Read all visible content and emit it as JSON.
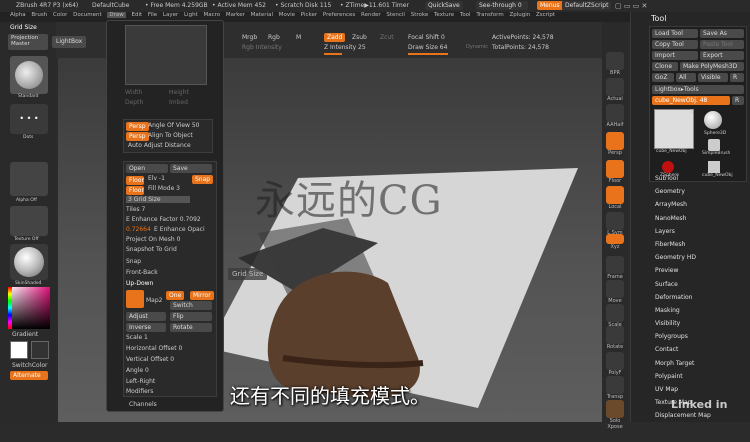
{
  "title_bar": {
    "app": "ZBrush 4R7 P3 (x64)",
    "doc": "DefaultCube",
    "free_mem": "• Free Mem 4.259GB",
    "active_mem": "• Active Mem 452",
    "scratch": "• Scratch Disk 115",
    "ztime": "• ZTime▶11.601 Timer",
    "quicksave": "QuickSave",
    "see_through": "See-through  0",
    "menus": "Menus",
    "script": "DefaultZScript"
  },
  "menu": [
    "Alpha",
    "Brush",
    "Color",
    "Document",
    "Draw",
    "Edit",
    "File",
    "Layer",
    "Light",
    "Macro",
    "Marker",
    "Material",
    "Movie",
    "Picker",
    "Preferences",
    "Render",
    "Stencil",
    "Stroke",
    "Texture",
    "Tool",
    "Transform",
    "Zplugin",
    "Zscript"
  ],
  "left_shelf": {
    "grid_size": "Grid Size",
    "projection_master": "Projection Master",
    "lightbox": "LightBox",
    "standard": "Standard",
    "dots": "Dots",
    "alpha_off": "Alpha Off",
    "texture_off": "Texture Off",
    "matcap": "SkinShade4",
    "gradient": "Gradient",
    "switch_color": "SwitchColor",
    "alternate": "Alternate"
  },
  "top_toolbar": {
    "mrgb": "Mrgb",
    "rgb": "Rgb",
    "m": "M",
    "rgb_intensity": "Rgb Intensity",
    "zadd": "Zadd",
    "zsub": "Zsub",
    "zcut": "Zcut",
    "z_intensity": "Z Intensity 25",
    "focal_shift": "Focal Shift 0",
    "draw_size": "Draw Size 64",
    "dynamic": "Dynamic",
    "active_points": "ActivePoints: 24,578",
    "total_points": "TotalPoints: 24,578"
  },
  "draw_panel": {
    "width": "Width",
    "height": "Height",
    "depth": "Depth",
    "imbed": "Imbed",
    "angle_of_view": "Angle Of View 50",
    "align_to_object": "Align To Object",
    "auto_adjust_distance": "Auto Adjust Distance",
    "persp": "Persp",
    "open": "Open",
    "save": "Save",
    "floor": "Floor",
    "elv": "Elv -1",
    "snap_btn": "Snap",
    "fill_mode": "Fill Mode 3",
    "grid_size": "3 Grid Size",
    "tiles": "Tiles 7",
    "e_enhance_factor": "E Enhance Factor 0.7092",
    "e_enhance_opacity_value": "0.72664",
    "e_enhance_opacity": "E Enhance Opaci",
    "project_on_mesh": "Project On Mesh 0",
    "snapshot_to_grid": "Snapshot To Grid",
    "snap": "Snap",
    "rear_to_back": "Front-Back",
    "up_down": "Up-Down",
    "map2": "Map2",
    "one": "One",
    "mirror": "Mirror",
    "switch": "Switch",
    "adjust": "Adjust",
    "flip": "Flip",
    "inverse": "Inverse",
    "rotate": "Rotate",
    "scale": "Scale 1",
    "horizontal_offset": "Horizontal Offset 0",
    "vertical_offset": "Vertical Offset 0",
    "angle": "Angle 0",
    "left_right": "Left-Right",
    "modifiers": "Modifiers",
    "channels": "Channels"
  },
  "tooltip": "Grid Size",
  "watermark": "永远的CG",
  "subtitle": "还有不同的填充模式。",
  "linkedin": "Linked in",
  "right_shelf": [
    "BPR",
    "SPix 3",
    "Actual",
    "AAHalf",
    "Persp",
    "Floor",
    "Local",
    "L.Sym",
    "Xyz",
    "Frame",
    "Move",
    "Scale",
    "Rotate",
    "Line Fill",
    "PolyF",
    "Transp",
    "Solo",
    "Xpose"
  ],
  "tool_panel": {
    "title": "Tool",
    "load_tool": "Load Tool",
    "save_as": "Save As",
    "copy_tool": "Copy Tool",
    "paste_tool": "Paste Tool",
    "import": "Import",
    "export": "Export",
    "clone": "Clone",
    "make_polymesh": "Make PolyMesh3D",
    "goz": "GoZ",
    "all": "All",
    "visible": "Visible",
    "r": "R",
    "lightbox_tools": "Lightbox▸Tools",
    "current_tool": "cube_NewObj. 48",
    "r2": "R",
    "thumbs": [
      "cube_NewObj",
      "Sphere3D",
      "SimpleBrush",
      "ZSphere",
      "cube_NewObj"
    ],
    "count": "2",
    "items": [
      "SubTool",
      "Geometry",
      "ArrayMesh",
      "NanoMesh",
      "Layers",
      "FiberMesh",
      "Geometry HD",
      "Preview",
      "Surface",
      "Deformation",
      "Masking",
      "Visibility",
      "Polygroups",
      "Contact",
      "Morph Target",
      "Polypaint",
      "UV Map",
      "Texture Map",
      "Displacement Map"
    ]
  }
}
